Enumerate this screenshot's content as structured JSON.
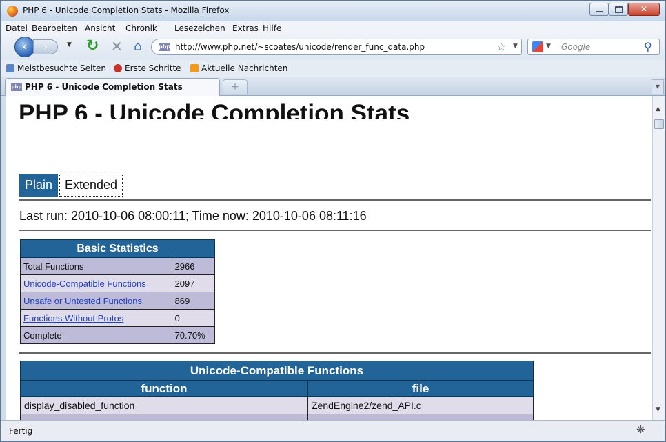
{
  "window": {
    "title": "PHP 6 - Unicode Completion Stats - Mozilla Firefox"
  },
  "menu": [
    "Datei",
    "Bearbeiten",
    "Ansicht",
    "Chronik",
    "Lesezeichen",
    "Extras",
    "Hilfe"
  ],
  "nav": {
    "url": "http://www.php.net/~scoates/unicode/render_func_data.php",
    "search_placeholder": "Google",
    "site_badge": "php"
  },
  "bookmarks": [
    "Meistbesuchte Seiten",
    "Erste Schritte",
    "Aktuelle Nachrichten"
  ],
  "tab": {
    "label": "PHP 6 - Unicode Completion Stats",
    "new_tab_symbol": "+"
  },
  "page": {
    "title": "PHP 6 - Unicode Completion Stats",
    "view_tabs": [
      "Plain",
      "Extended"
    ],
    "last_run": "Last run: 2010-10-06 08:00:11; Time now: 2010-10-06 08:11:16",
    "basic_stats": {
      "title": "Basic Statistics",
      "rows": [
        {
          "label": "Total Functions",
          "value": "2966",
          "link": false
        },
        {
          "label": "Unicode-Compatible Functions",
          "value": "2097",
          "link": true
        },
        {
          "label": "Unsafe or Untested Functions",
          "value": "869",
          "link": true
        },
        {
          "label": "Functions Without Protos",
          "value": "0",
          "link": true
        },
        {
          "label": "Complete",
          "value": "70.70%",
          "link": false
        }
      ]
    },
    "unicode_functions": {
      "title": "Unicode-Compatible Functions",
      "columns": [
        "function",
        "file"
      ],
      "rows": [
        {
          "function": "display_disabled_function",
          "file": "ZendEngine2/zend_API.c"
        }
      ]
    }
  },
  "status": {
    "text": "Fertig"
  },
  "colors": {
    "table_header": "#226498",
    "row_odd": "#bebbd8",
    "row_even": "#e1dcea",
    "link": "#1e40c6"
  }
}
